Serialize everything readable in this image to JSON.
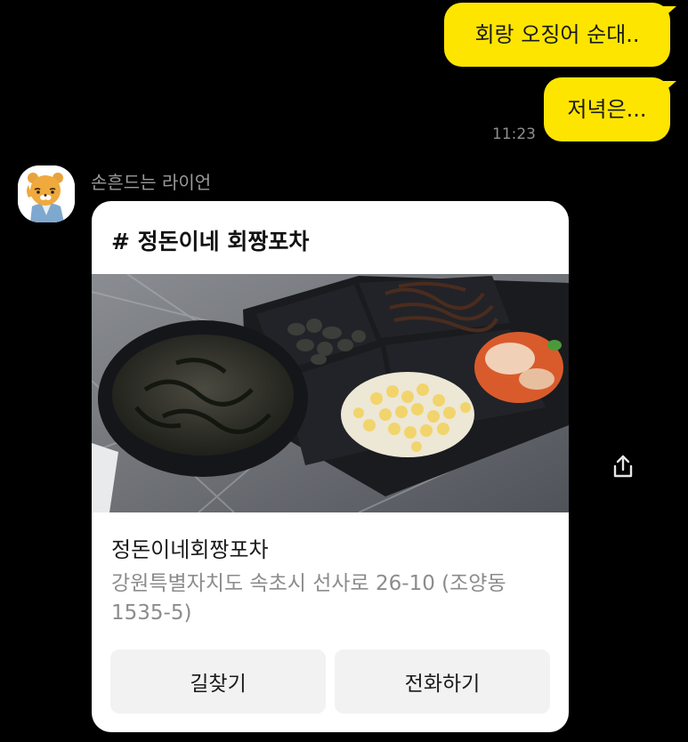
{
  "messages": [
    {
      "text": "회랑 오징어 순대.."
    },
    {
      "text": "저녁은..."
    }
  ],
  "time": "11:23",
  "sender": {
    "name": "손흔드는 라이언",
    "avatar_icon": "ryan-character-icon"
  },
  "card": {
    "title": "# 정돈이네 회짱포차",
    "place_name": "정돈이네회짱포차",
    "address": "강원특별자치도 속초시 선사로 26-10 (조양동 1535-5)",
    "buttons": {
      "directions": "길찾기",
      "call": "전화하기"
    }
  },
  "share_icon": "share-icon",
  "colors": {
    "my_bubble": "#FEE500",
    "background": "#000000",
    "card": "#FFFFFF"
  }
}
